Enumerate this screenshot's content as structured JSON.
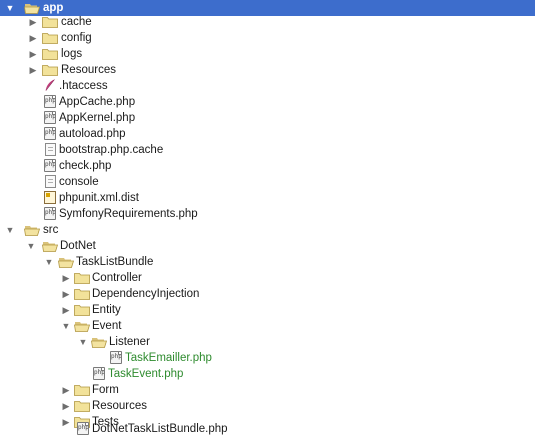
{
  "tree": {
    "app": "app",
    "app_children": {
      "cache": "cache",
      "config": "config",
      "logs": "logs",
      "resources": "Resources",
      "htaccess": ".htaccess",
      "appcache": "AppCache.php",
      "appkernel": "AppKernel.php",
      "autoload": "autoload.php",
      "bootstrap": "bootstrap.php.cache",
      "check": "check.php",
      "console": "console",
      "phpunit": "phpunit.xml.dist",
      "symfonyreq": "SymfonyRequirements.php"
    },
    "src": "src",
    "dotnet": "DotNet",
    "tasklistbundle": "TaskListBundle",
    "bundle_children": {
      "controller": "Controller",
      "dependencyinjection": "DependencyInjection",
      "entity": "Entity",
      "event": "Event",
      "listener": "Listener",
      "taskemailler": "TaskEmailler.php",
      "taskevent": "TaskEvent.php",
      "form": "Form",
      "resources": "Resources",
      "tests": "Tests",
      "bundlefile": "DotNetTaskListBundle.php"
    }
  },
  "icons": {
    "php_badge": "php",
    "selected_bg": "#3d6dcc",
    "modified_text": "#2e8b2e"
  }
}
